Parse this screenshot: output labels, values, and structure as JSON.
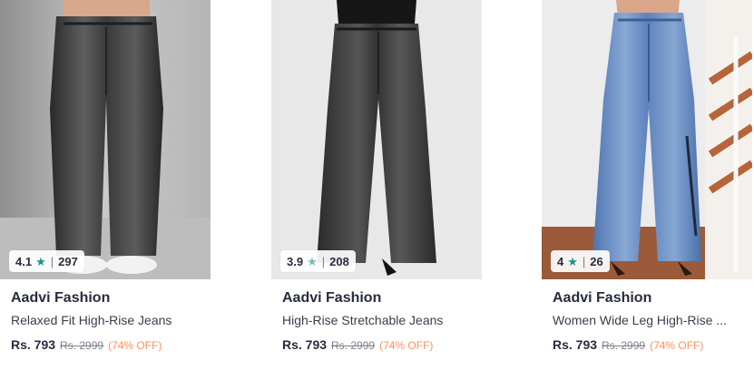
{
  "products": [
    {
      "brand": "Aadvi Fashion",
      "name": "Relaxed Fit High-Rise Jeans",
      "rating": "4.1",
      "rating_count": "297",
      "price": "Rs. 793",
      "mrp": "Rs. 2999",
      "discount": "(74% OFF)"
    },
    {
      "brand": "Aadvi Fashion",
      "name": "High-Rise Stretchable Jeans",
      "rating": "3.9",
      "rating_count": "208",
      "price": "Rs. 793",
      "mrp": "Rs. 2999",
      "discount": "(74% OFF)"
    },
    {
      "brand": "Aadvi Fashion",
      "name": "Women Wide Leg High-Rise ...",
      "rating": "4",
      "rating_count": "26",
      "price": "Rs. 793",
      "mrp": "Rs. 2999",
      "discount": "(74% OFF)"
    }
  ],
  "icons": {
    "rating": "star-icon"
  },
  "colors": {
    "star": "#14958f",
    "discount": "#ff905a",
    "text": "#282c3f"
  }
}
